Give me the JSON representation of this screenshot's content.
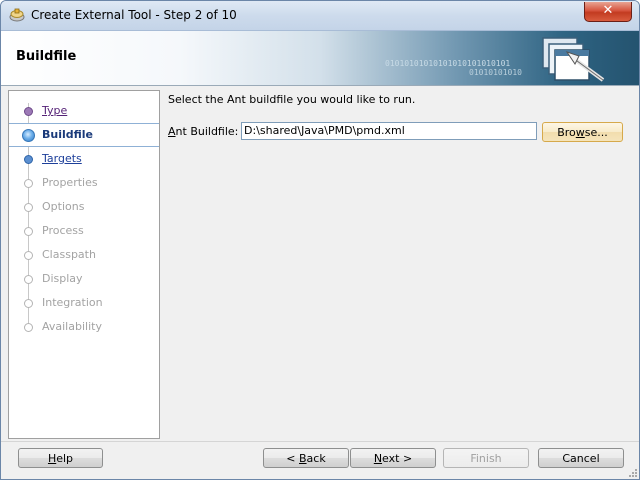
{
  "window": {
    "title": "Create External Tool - Step 2 of 10",
    "close_glyph": "✕"
  },
  "banner": {
    "title": "Buildfile",
    "binary_text": "01010101010101010101010101",
    "binary_text2": "01010101010"
  },
  "nav": {
    "items": [
      {
        "label": "Type",
        "state": "done"
      },
      {
        "label": "Buildfile",
        "state": "current"
      },
      {
        "label": "Targets",
        "state": "next"
      },
      {
        "label": "Properties",
        "state": "disabled"
      },
      {
        "label": "Options",
        "state": "disabled"
      },
      {
        "label": "Process",
        "state": "disabled"
      },
      {
        "label": "Classpath",
        "state": "disabled"
      },
      {
        "label": "Display",
        "state": "disabled"
      },
      {
        "label": "Integration",
        "state": "disabled"
      },
      {
        "label": "Availability",
        "state": "disabled"
      }
    ]
  },
  "content": {
    "instruction": "Select the Ant buildfile you would like to run.",
    "field_label_mnemonic": "A",
    "field_label_rest": "nt Buildfile:",
    "field_value": "D:\\shared\\Java\\PMD\\pmd.xml",
    "browse_mnemonic": "w",
    "browse_pre": "Bro",
    "browse_post": "se..."
  },
  "footer": {
    "help_pre": "",
    "help_mn": "H",
    "help_post": "elp",
    "back_pre": "< ",
    "back_mn": "B",
    "back_post": "ack",
    "next_pre": "",
    "next_mn": "N",
    "next_post": "ext >",
    "finish_label": "Finish",
    "cancel_label": "Cancel"
  },
  "colors": {
    "accent": "#2e77c4",
    "done_link": "#552277",
    "next_link": "#1d3f9a",
    "disabled": "#a3a3a3"
  }
}
